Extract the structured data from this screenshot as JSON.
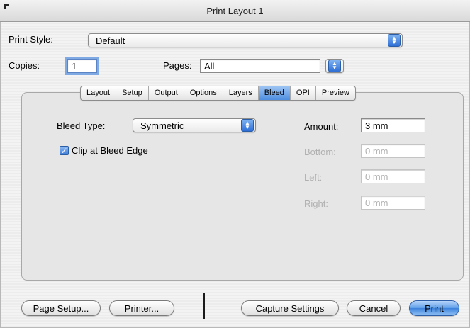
{
  "window": {
    "title": "Print Layout 1"
  },
  "print_style": {
    "label": "Print Style:",
    "value": "Default"
  },
  "copies": {
    "label": "Copies:",
    "value": "1"
  },
  "pages": {
    "label": "Pages:",
    "value": "All"
  },
  "tabs": [
    {
      "label": "Layout"
    },
    {
      "label": "Setup"
    },
    {
      "label": "Output"
    },
    {
      "label": "Options"
    },
    {
      "label": "Layers"
    },
    {
      "label": "Bleed",
      "selected": true
    },
    {
      "label": "OPI"
    },
    {
      "label": "Preview"
    }
  ],
  "bleed": {
    "type_label": "Bleed Type:",
    "type_value": "Symmetric",
    "clip_label": "Clip at Bleed Edge",
    "clip_checked": true,
    "amount_label": "Amount:",
    "amount_value": "3 mm",
    "bottom_label": "Bottom:",
    "bottom_value": "0 mm",
    "left_label": "Left:",
    "left_value": "0 mm",
    "right_label": "Right:",
    "right_value": "0 mm"
  },
  "buttons": {
    "page_setup": "Page Setup...",
    "printer": "Printer...",
    "capture_settings": "Capture Settings",
    "cancel": "Cancel",
    "print": "Print"
  },
  "colors": {
    "accent": "#3c82dc"
  }
}
